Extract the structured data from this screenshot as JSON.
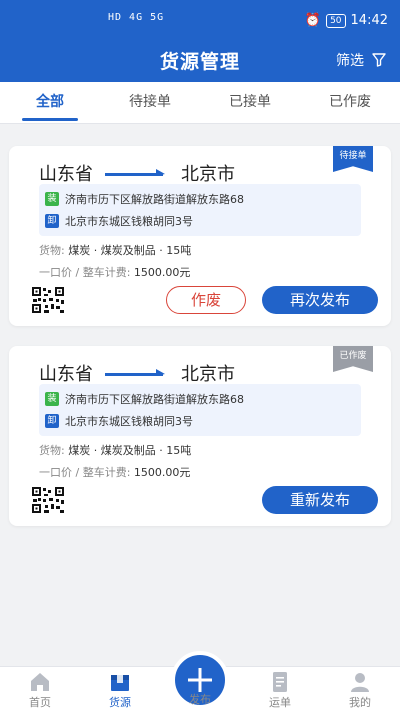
{
  "status_bar": {
    "signal": "HD 4G 5G",
    "time": "14:42",
    "battery": "50"
  },
  "header": {
    "title": "货源管理",
    "filter_label": "筛选"
  },
  "tabs": [
    {
      "label": "全部",
      "active": true
    },
    {
      "label": "待接单",
      "active": false
    },
    {
      "label": "已接单",
      "active": false
    },
    {
      "label": "已作废",
      "active": false
    }
  ],
  "cards": [
    {
      "status": "待接单",
      "origin": "山东省",
      "destination": "北京市",
      "load_tag": "装",
      "load_address": "济南市历下区解放路街道解放东路68",
      "unload_tag": "卸",
      "unload_address": "北京市东城区钱粮胡同3号",
      "goods_label": "货物:",
      "goods": "煤炭 · 煤炭及制品 · 15吨",
      "price_label": "一口价 / 整车计费:",
      "price": "1500.00元",
      "secondary_button": "作废",
      "primary_button": "再次发布"
    },
    {
      "status": "已作废",
      "origin": "山东省",
      "destination": "北京市",
      "load_tag": "装",
      "load_address": "济南市历下区解放路街道解放东路68",
      "unload_tag": "卸",
      "unload_address": "北京市东城区钱粮胡同3号",
      "goods_label": "货物:",
      "goods": "煤炭 · 煤炭及制品 · 15吨",
      "price_label": "一口价 / 整车计费:",
      "price": "1500.00元",
      "primary_button": "重新发布"
    }
  ],
  "bottom_nav": [
    {
      "label": "首页",
      "icon": "home-icon",
      "active": false
    },
    {
      "label": "货源",
      "icon": "cargo-icon",
      "active": true
    },
    {
      "label": "发布",
      "icon": "plus-icon",
      "active": false
    },
    {
      "label": "运单",
      "icon": "waybill-icon",
      "active": false
    },
    {
      "label": "我的",
      "icon": "user-icon",
      "active": false
    }
  ],
  "colors": {
    "primary": "#2163c9",
    "danger": "#d9453a",
    "load_tag": "#3bb44a",
    "void_gray": "#9a9ea6"
  }
}
